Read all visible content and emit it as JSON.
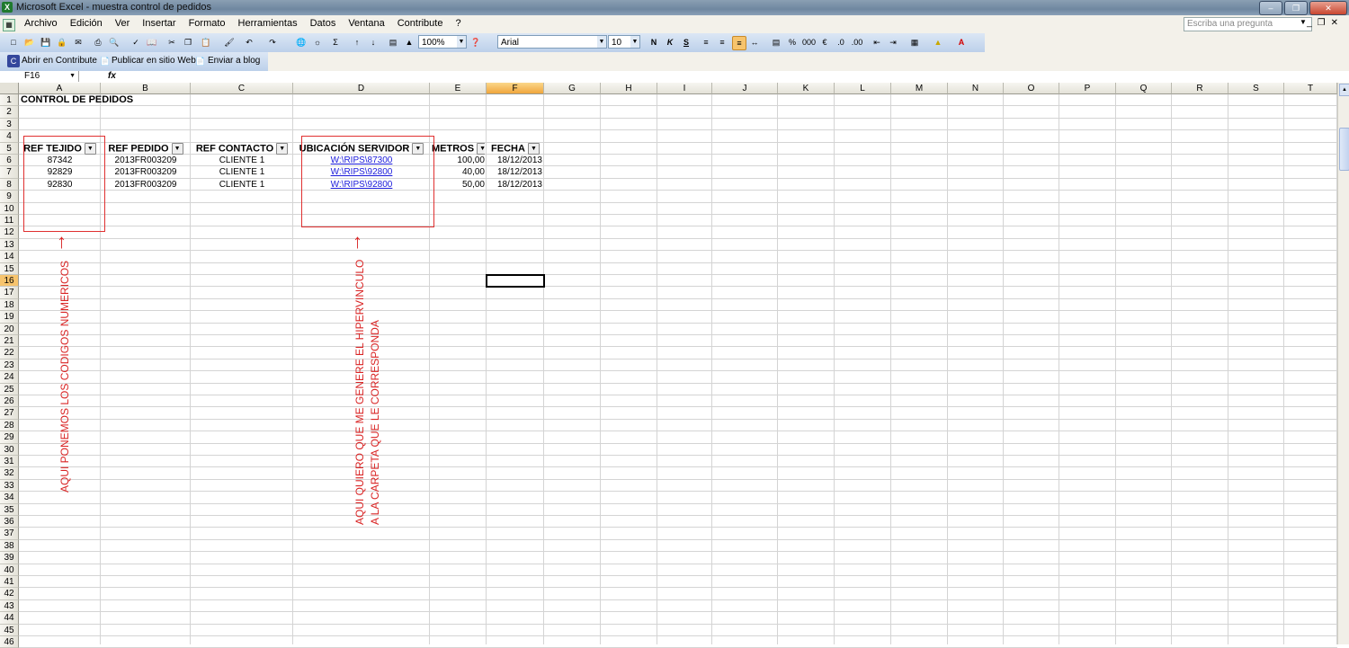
{
  "window": {
    "title": "Microsoft Excel - muestra control de pedidos",
    "app_icon": "X"
  },
  "menu": [
    "Archivo",
    "Edición",
    "Ver",
    "Insertar",
    "Formato",
    "Herramientas",
    "Datos",
    "Ventana",
    "Contribute",
    "?"
  ],
  "ask": {
    "placeholder": "Escriba una pregunta"
  },
  "toolbar": {
    "zoom": "100%",
    "font": "Arial",
    "size": "10"
  },
  "contribute_bar": {
    "open": "Abrir en Contribute",
    "publish": "Publicar en sitio Web",
    "blog": "Enviar a blog"
  },
  "formula": {
    "cell_ref": "F16",
    "fx": "fx"
  },
  "columns": [
    "A",
    "B",
    "C",
    "D",
    "E",
    "F",
    "G",
    "H",
    "I",
    "J",
    "K",
    "L",
    "M",
    "N",
    "O",
    "P",
    "Q",
    "R",
    "S",
    "T"
  ],
  "rows": [
    "1",
    "2",
    "3",
    "4",
    "5",
    "6",
    "7",
    "8",
    "9",
    "10",
    "11",
    "12",
    "13",
    "14",
    "15",
    "16",
    "17",
    "18",
    "19",
    "20",
    "21",
    "22",
    "23",
    "24",
    "25",
    "26",
    "27",
    "28",
    "29",
    "30",
    "31",
    "32",
    "33",
    "34",
    "35",
    "36",
    "37",
    "38",
    "39",
    "40",
    "41",
    "42",
    "43",
    "44",
    "45",
    "46"
  ],
  "sheet": {
    "title": "CONTROL DE PEDIDOS",
    "headers": [
      "REF TEJIDO",
      "REF PEDIDO",
      "REF CONTACTO",
      "UBICACIÓN SERVIDOR",
      "METROS",
      "FECHA"
    ],
    "data": [
      [
        "87342",
        "2013FR003209",
        "CLIENTE 1",
        "W:\\RIPS\\87300",
        "100,00",
        "18/12/2013"
      ],
      [
        "92829",
        "2013FR003209",
        "CLIENTE 1",
        "W:\\RIPS\\92800",
        "40,00",
        "18/12/2013"
      ],
      [
        "92830",
        "2013FR003209",
        "CLIENTE 1",
        "W:\\RIPS\\92800",
        "50,00",
        "18/12/2013"
      ]
    ]
  },
  "annotations": {
    "left": "AQUI PONEMOS LOS CODIGOS NUMERICOS",
    "right_line1": "AQUI QUIERO QUE ME GENERE EL HIPERVINCULO",
    "right_line2": "A LA CARPETA QUE LE CORRESPONDA",
    "color": "#d92424"
  },
  "selected_cell": "F16"
}
